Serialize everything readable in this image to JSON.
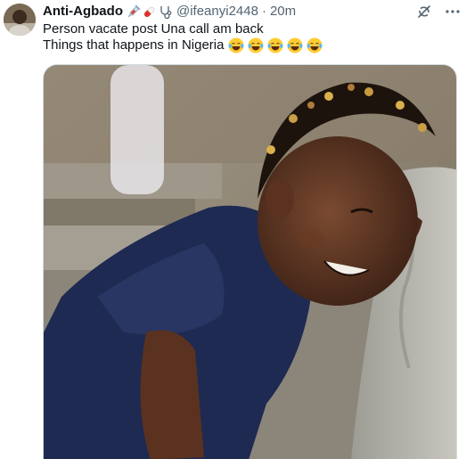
{
  "post": {
    "display_name": "Anti-Agbado",
    "name_emojis": [
      "syringe-icon",
      "pill-icon",
      "stethoscope-icon"
    ],
    "handle": "@ifeanyi2448",
    "separator": "·",
    "time": "20m",
    "text_line1": "Person vacate post Una call am back",
    "text_line2": "Things that happens in Nigeria",
    "trailing_emojis": [
      "laughing-tears-emoji",
      "laughing-tears-emoji",
      "laughing-tears-emoji",
      "laughing-tears-emoji",
      "laughing-tears-emoji"
    ]
  },
  "actions": {
    "grok_icon": "grok-icon",
    "more_icon": "more-options-icon"
  },
  "media": {
    "description_icon": "photo-of-smiling-child-leaning-on-wall"
  },
  "colors": {
    "text_primary": "#0f1419",
    "text_secondary": "#536471",
    "border": "#cfd9de"
  }
}
